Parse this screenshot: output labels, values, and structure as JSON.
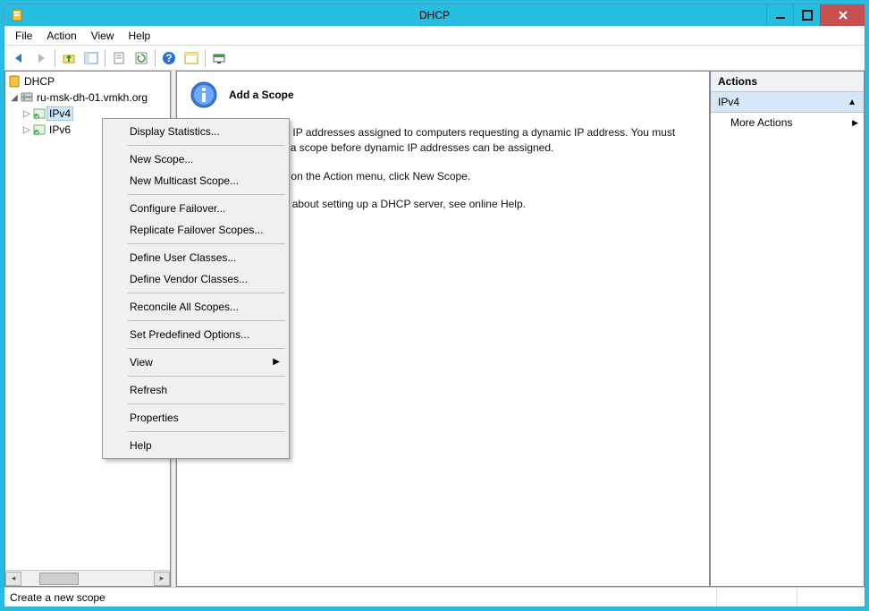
{
  "window": {
    "title": "DHCP"
  },
  "menubar": {
    "file": "File",
    "action": "Action",
    "view": "View",
    "help": "Help"
  },
  "tree": {
    "root": "DHCP",
    "server": "ru-msk-dh-01.vmkh.org",
    "ipv4": "IPv4",
    "ipv6": "IPv6"
  },
  "main": {
    "heading": "Add a Scope",
    "p1": "A scope is a range of IP addresses assigned to computers requesting a dynamic IP address. You must create and configure a scope before dynamic IP addresses can be assigned.",
    "p2": "To add a new scope, on the Action menu, click New Scope.",
    "p3": "For more information about setting up a DHCP server, see online Help."
  },
  "actions": {
    "header": "Actions",
    "group": "IPv4",
    "more": "More Actions"
  },
  "context_menu": {
    "display_statistics": "Display Statistics...",
    "new_scope": "New Scope...",
    "new_multicast": "New Multicast Scope...",
    "configure_failover": "Configure Failover...",
    "replicate_failover": "Replicate Failover Scopes...",
    "define_user": "Define User Classes...",
    "define_vendor": "Define Vendor Classes...",
    "reconcile": "Reconcile All Scopes...",
    "set_predefined": "Set Predefined Options...",
    "view": "View",
    "refresh": "Refresh",
    "properties": "Properties",
    "help": "Help"
  },
  "status": {
    "text": "Create a new scope"
  }
}
